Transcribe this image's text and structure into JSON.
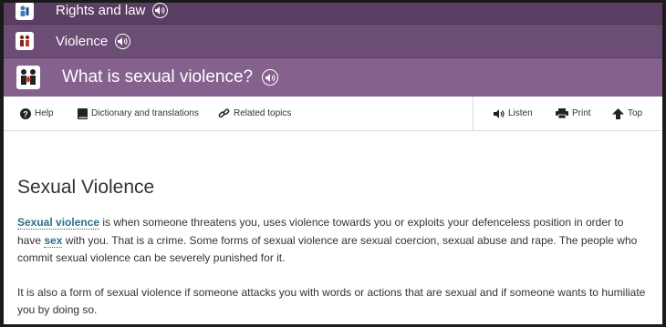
{
  "breadcrumbs": [
    {
      "label": "Rights and law",
      "icon": "rights-law-icon"
    },
    {
      "label": "Violence",
      "icon": "violence-icon"
    }
  ],
  "page_header": {
    "title": "What is sexual violence?",
    "icon": "sexual-violence-icon"
  },
  "toolbar": {
    "help": "Help",
    "dictionary": "Dictionary and translations",
    "related": "Related topics",
    "listen": "Listen",
    "print": "Print",
    "top": "Top"
  },
  "article": {
    "heading": "Sexual Violence",
    "p1_term1": "Sexual violence",
    "p1_text1": " is when someone threatens you, uses violence towards you or exploits your defenceless position in order to have ",
    "p1_term2": "sex",
    "p1_text2": " with you. That is a crime. Some forms of sexual violence are sexual coercion, sexual abuse and rape. The people who commit sexual violence can be severely punished for it.",
    "p2": "It is also a form of sexual violence if someone attacks you with words or actions that are sexual and if someone wants to humiliate you by doing so."
  },
  "colors": {
    "nav_dark": "#5a3f62",
    "nav_mid": "#6c4d74",
    "nav_light": "#85628d",
    "link": "#2b6f8a"
  }
}
